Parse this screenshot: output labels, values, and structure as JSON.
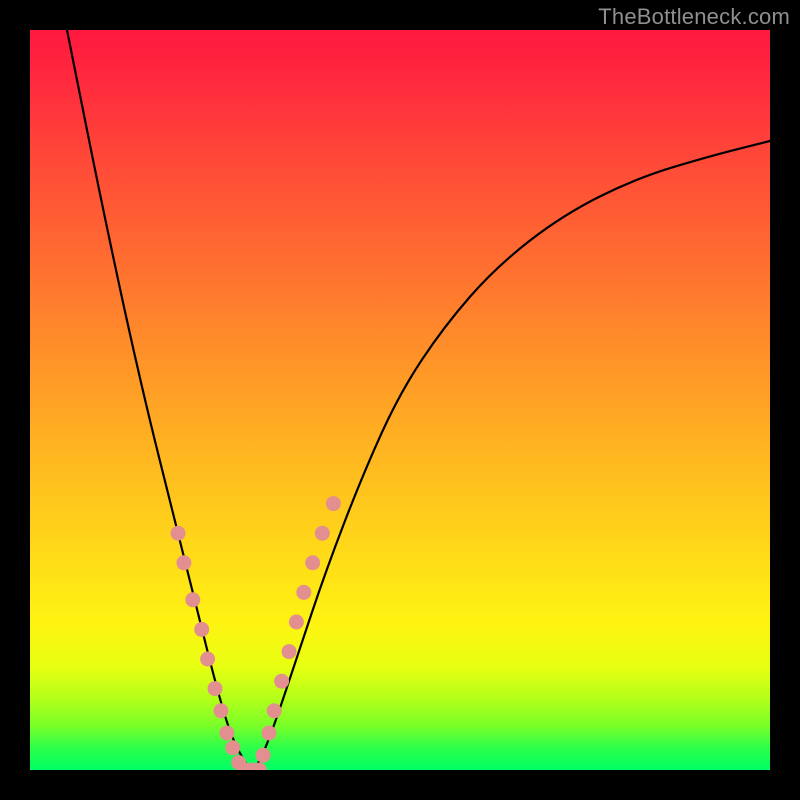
{
  "watermark": "TheBottleneck.com",
  "chart_data": {
    "type": "line",
    "title": "",
    "xlabel": "",
    "ylabel": "",
    "xlim": [
      0,
      100
    ],
    "ylim": [
      0,
      100
    ],
    "grid": false,
    "legend": false,
    "background_gradient": {
      "top": "#ff183f",
      "bottom": "#00ff66",
      "note": "vertical rainbow gradient red→orange→yellow→green"
    },
    "series": [
      {
        "name": "bottleneck-curve",
        "stroke": "#000000",
        "x": [
          5,
          10,
          15,
          20,
          23,
          25,
          27,
          29,
          30,
          31,
          33,
          36,
          40,
          45,
          50,
          56,
          63,
          72,
          82,
          92,
          100
        ],
        "y": [
          100,
          75,
          52,
          32,
          20,
          12,
          5,
          1,
          0,
          1,
          6,
          15,
          27,
          40,
          51,
          60,
          68,
          75,
          80,
          83,
          85
        ]
      },
      {
        "name": "highlight-dots-left",
        "type": "scatter",
        "color": "#e38f8f",
        "x": [
          20.0,
          20.8,
          22.0,
          23.2,
          24.0,
          25.0,
          25.8,
          26.6,
          27.4,
          28.2
        ],
        "y": [
          32,
          28,
          23,
          19,
          15,
          11,
          8,
          5,
          3,
          1
        ]
      },
      {
        "name": "highlight-dots-right",
        "type": "scatter",
        "color": "#e38f8f",
        "x": [
          31.5,
          32.3,
          33.0,
          34.0,
          35.0,
          36.0,
          37.0,
          38.2,
          39.5,
          41.0
        ],
        "y": [
          2,
          5,
          8,
          12,
          16,
          20,
          24,
          28,
          32,
          36
        ]
      },
      {
        "name": "highlight-dots-bottom",
        "type": "scatter",
        "color": "#e38f8f",
        "x": [
          29.0,
          30.0,
          31.0
        ],
        "y": [
          0,
          0,
          0
        ]
      }
    ]
  }
}
